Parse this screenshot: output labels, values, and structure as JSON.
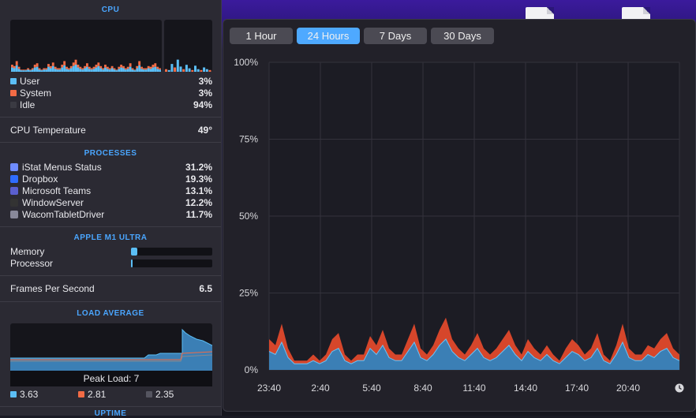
{
  "cpu": {
    "title": "CPU",
    "user": {
      "label": "User",
      "value": "3%",
      "color": "#5bbef5"
    },
    "system": {
      "label": "System",
      "value": "3%",
      "color": "#f26b45"
    },
    "idle": {
      "label": "Idle",
      "value": "94%",
      "color": "#3a3a42"
    }
  },
  "temperature": {
    "label": "CPU Temperature",
    "value": "49°"
  },
  "processes": {
    "title": "PROCESSES",
    "items": [
      {
        "name": "iStat Menus Status",
        "value": "31.2%",
        "icon": "istat-icon",
        "color": "#6f8cff"
      },
      {
        "name": "Dropbox",
        "value": "19.3%",
        "icon": "dropbox-icon",
        "color": "#2f6cff"
      },
      {
        "name": "Microsoft Teams",
        "value": "13.1%",
        "icon": "teams-icon",
        "color": "#5a5fcf"
      },
      {
        "name": "WindowServer",
        "value": "12.2%",
        "icon": "windowserver-icon",
        "color": "#333333"
      },
      {
        "name": "WacomTabletDriver",
        "value": "11.7%",
        "icon": "wacom-icon",
        "color": "#888899"
      }
    ]
  },
  "gpu": {
    "title": "APPLE M1 ULTRA",
    "memory": {
      "label": "Memory",
      "fraction": 0.08
    },
    "processor": {
      "label": "Processor",
      "fraction": 0.01
    }
  },
  "fps": {
    "label": "Frames Per Second",
    "value": "6.5"
  },
  "load": {
    "title": "LOAD AVERAGE",
    "peak": "Peak Load: 7",
    "values": [
      {
        "value": "3.63",
        "color": "#5bbef5"
      },
      {
        "value": "2.81",
        "color": "#f26b45"
      },
      {
        "value": "2.35",
        "color": "#555560"
      }
    ]
  },
  "uptime_title": "UPTIME",
  "ranges": [
    "1 Hour",
    "24 Hours",
    "7 Days",
    "30 Days"
  ],
  "active_range": "24 Hours",
  "chart_data": {
    "type": "area",
    "y_ticks": [
      "100%",
      "75%",
      "50%",
      "25%",
      "0%"
    ],
    "x_ticks": [
      "23:40",
      "2:40",
      "5:40",
      "8:40",
      "11:40",
      "14:40",
      "17:40",
      "20:40"
    ],
    "ylim": [
      0,
      100
    ],
    "grid": true,
    "series": [
      {
        "name": "User",
        "color": "#3b7fb5",
        "values": [
          6,
          5,
          9,
          4,
          2,
          2,
          2,
          3,
          2,
          3,
          6,
          7,
          3,
          2,
          3,
          3,
          7,
          5,
          8,
          4,
          3,
          3,
          6,
          9,
          4,
          3,
          5,
          8,
          10,
          6,
          4,
          3,
          5,
          7,
          4,
          3,
          4,
          6,
          8,
          5,
          3,
          6,
          4,
          3,
          5,
          3,
          2,
          4,
          6,
          5,
          3,
          4,
          7,
          3,
          2,
          5,
          9,
          4,
          3,
          3,
          5,
          4,
          6,
          7,
          4,
          3
        ]
      },
      {
        "name": "System",
        "color": "#d6462b",
        "values": [
          4,
          3,
          6,
          3,
          1,
          1,
          1,
          2,
          1,
          2,
          4,
          5,
          2,
          1,
          2,
          2,
          4,
          3,
          5,
          3,
          2,
          2,
          4,
          6,
          3,
          2,
          3,
          5,
          7,
          4,
          3,
          2,
          3,
          5,
          3,
          2,
          3,
          4,
          5,
          3,
          2,
          4,
          3,
          2,
          3,
          2,
          1,
          3,
          4,
          3,
          2,
          3,
          5,
          2,
          1,
          3,
          6,
          3,
          2,
          2,
          3,
          3,
          4,
          5,
          3,
          2
        ]
      }
    ],
    "clock_icon": "clock-icon"
  }
}
